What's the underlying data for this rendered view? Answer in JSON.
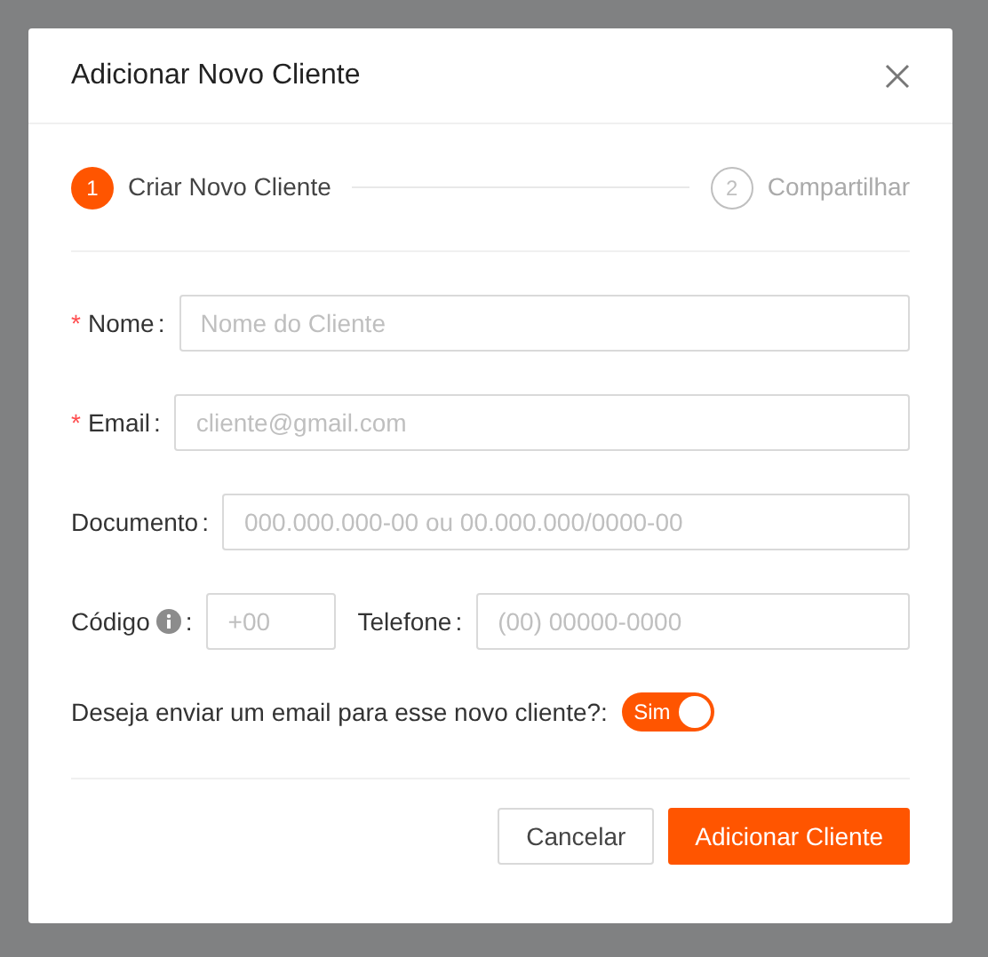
{
  "dialog": {
    "title": "Adicionar Novo Cliente"
  },
  "steps": [
    {
      "number": "1",
      "label": "Criar Novo Cliente",
      "selected": true
    },
    {
      "number": "2",
      "label": "Compartilhar",
      "selected": false
    }
  ],
  "rows": [
    {
      "fields": [
        {
          "kind": "wide",
          "marker": "*",
          "label": "Nome",
          "suffix": ":",
          "placeholder": "Nome do Cliente"
        }
      ]
    },
    {
      "fields": [
        {
          "kind": "wide",
          "marker": "*",
          "label": "Email",
          "suffix": ":",
          "placeholder": "cliente@gmail.com"
        }
      ]
    },
    {
      "fields": [
        {
          "kind": "wide",
          "label": "Documento",
          "suffix": ":",
          "placeholder": "000.000.000-00 ou 00.000.000/0000-00"
        }
      ]
    },
    {
      "fields": [
        {
          "kind": "narrow",
          "label": "Código",
          "info": true,
          "suffix": ":",
          "placeholder": "+00"
        },
        {
          "kind": "wide",
          "label": "Telefone",
          "suffix": ":",
          "placeholder": "(00) 00000-0000"
        }
      ]
    }
  ],
  "email_toggle": {
    "label": "Deseja enviar um email para esse novo cliente?:",
    "on": true,
    "text": "Sim"
  },
  "buttons": [
    {
      "label": "Cancelar",
      "kind": "default"
    },
    {
      "label": "Adicionar Cliente",
      "kind": "primary"
    }
  ]
}
